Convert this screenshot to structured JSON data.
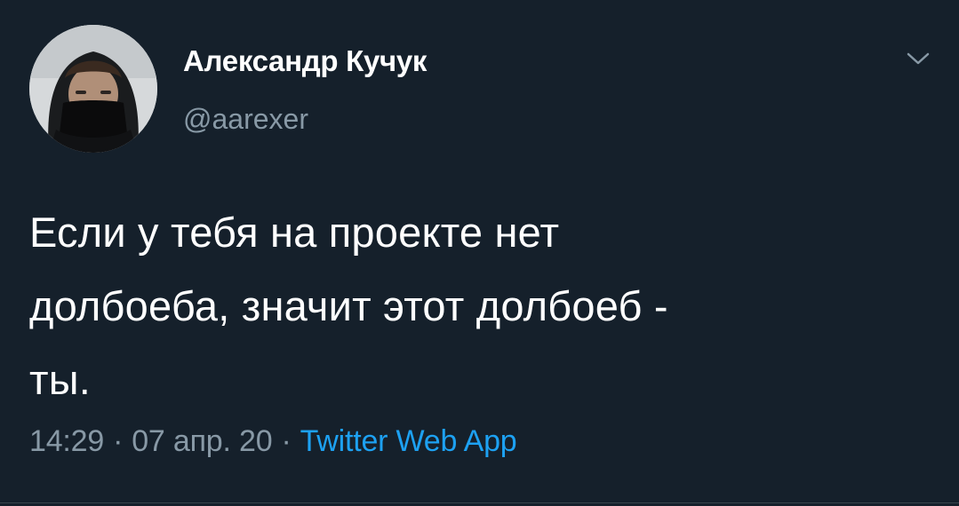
{
  "user": {
    "display_name": "Александр Кучук",
    "handle": "@aarexer"
  },
  "tweet": {
    "lines": [
      "Если у тебя на проекте нет",
      "долбоеба, значит этот долбоеб -",
      "ты."
    ],
    "time": "14:29",
    "date": "07 апр. 20",
    "separator": "·",
    "source": "Twitter Web App"
  },
  "icons": {
    "menu": "chevron-down-icon",
    "avatar": "user-avatar"
  },
  "colors": {
    "background": "#15202b",
    "text": "#ffffff",
    "secondary": "#8899a6",
    "link": "#1da1f2"
  }
}
